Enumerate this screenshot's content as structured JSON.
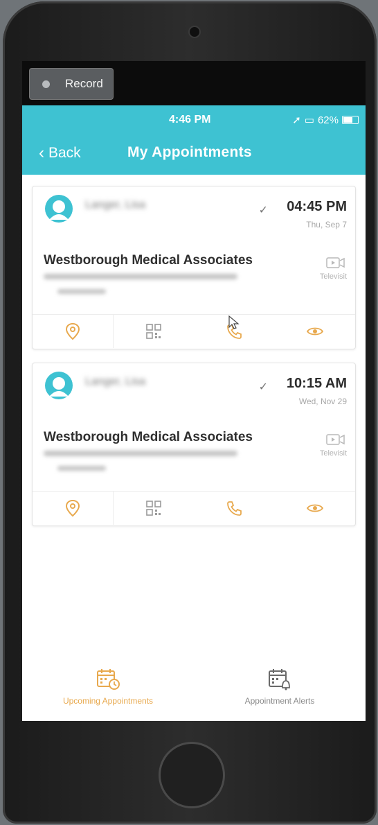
{
  "recorder": {
    "label": "Record"
  },
  "status_bar": {
    "time": "4:46 PM",
    "battery": "62%"
  },
  "nav": {
    "back_label": "Back",
    "title": "My Appointments"
  },
  "appointments": [
    {
      "patient": "Langer, Lisa",
      "time": "04:45 PM",
      "date": "Thu, Sep 7",
      "provider": "Westborough Medical Associates",
      "visit_type": "Televisit"
    },
    {
      "patient": "Langer, Lisa",
      "time": "10:15 AM",
      "date": "Wed, Nov 29",
      "provider": "Westborough Medical Associates",
      "visit_type": "Televisit"
    }
  ],
  "tabs": [
    {
      "label": "Upcoming Appointments",
      "active": true
    },
    {
      "label": "Appointment Alerts",
      "active": false
    }
  ],
  "colors": {
    "accent": "#3ec2d2",
    "action": "#e8a94e",
    "avatar": "#3ec2d2"
  },
  "icons": [
    "back-chevron-icon",
    "location-pin-icon",
    "qr-code-icon",
    "phone-icon",
    "eye-icon",
    "video-icon",
    "calendar-clock-icon",
    "calendar-bell-icon"
  ]
}
